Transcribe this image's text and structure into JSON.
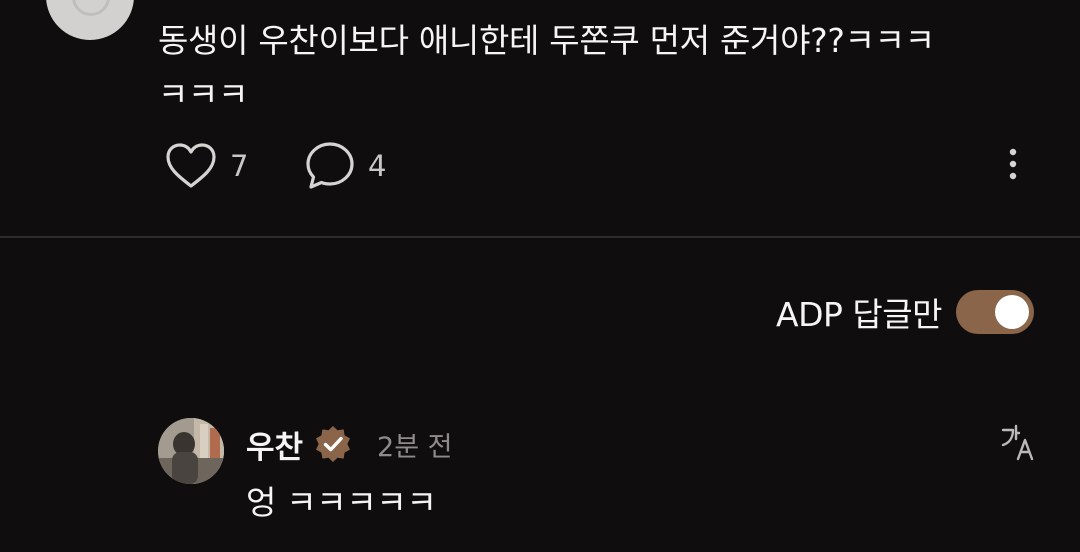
{
  "post": {
    "text": "동생이 우찬이보다 애니한테 두쫀쿠 먼저 준거야??ㅋㅋㅋㅋㅋㅋ",
    "like_count": "7",
    "comment_count": "4"
  },
  "filter": {
    "label": "ADP 답글만",
    "enabled": true
  },
  "reply": {
    "author": "우찬",
    "verified": true,
    "time": "2분 전",
    "text": "엉 ㅋㅋㅋㅋㅋ"
  },
  "icons": {
    "like": "heart-icon",
    "comment": "speech-bubble-icon",
    "more": "vertical-ellipsis-icon",
    "verified": "verified-badge-icon",
    "translate": "translate-icon"
  },
  "colors": {
    "background": "#0f0d0d",
    "toggle_on": "#8a6549",
    "verified_badge": "#8a6549",
    "secondary_text": "#8f8b8b"
  }
}
